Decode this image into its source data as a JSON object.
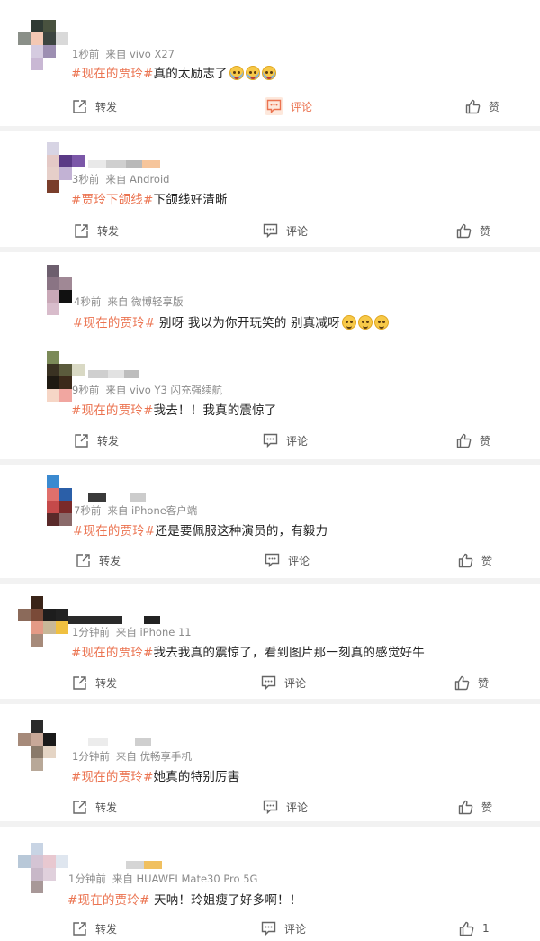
{
  "colors": {
    "accent": "#eb7350",
    "meta": "#8a8a8a",
    "separator": "#f2f2f2"
  },
  "icons": {
    "repost": "share-square-icon",
    "comment": "comment-bubble-icon",
    "like": "thumbs-up-icon",
    "emoji": "crying-laughing-emoji-icon"
  },
  "posts": [
    {
      "time": "1秒前",
      "source": "来自 vivo X27",
      "tag": "#现在的贾玲#",
      "text": "真的太励志了",
      "repost": "转发",
      "comment": "评论",
      "like": "赞"
    },
    {
      "time": "3秒前",
      "source": "来自 Android",
      "tag": "#贾玲下颌线#",
      "text": "下颌线好清晰",
      "repost": "转发",
      "comment": "评论",
      "like": "赞"
    },
    {
      "time": "4秒前",
      "source": "来自 微博轻享版",
      "tag": "#现在的贾玲#",
      "text": " 别呀 我以为你开玩笑的 别真减呀",
      "repost": "转发",
      "comment": "评论",
      "like": "赞"
    },
    {
      "time": "9秒前",
      "source": "来自 vivo Y3 闪充强续航",
      "tag": "#现在的贾玲#",
      "text": "我去！！我真的震惊了",
      "repost": "转发",
      "comment": "评论",
      "like": "赞"
    },
    {
      "time": "7秒前",
      "source": "来自 iPhone客户端",
      "tag": "#现在的贾玲#",
      "text": "还是要佩服这种演员的，有毅力",
      "repost": "转发",
      "comment": "评论",
      "like": "赞"
    },
    {
      "time": "1分钟前",
      "source": "来自 iPhone 11",
      "tag": "#现在的贾玲#",
      "text": "我去我真的震惊了，看到图片那一刻真的感觉好牛",
      "repost": "转发",
      "comment": "评论",
      "like": "赞"
    },
    {
      "time": "1分钟前",
      "source": "来自 优畅享手机",
      "tag": "#现在的贾玲#",
      "text": "她真的特别厉害",
      "repost": "转发",
      "comment": "评论",
      "like": "赞"
    },
    {
      "time": "1分钟前",
      "source": "来自 HUAWEI Mate30 Pro 5G",
      "tag": "#现在的贾玲#",
      "text": " 天呐！玲姐瘦了好多啊！！",
      "repost": "转发",
      "comment": "评论",
      "like": "1"
    }
  ]
}
